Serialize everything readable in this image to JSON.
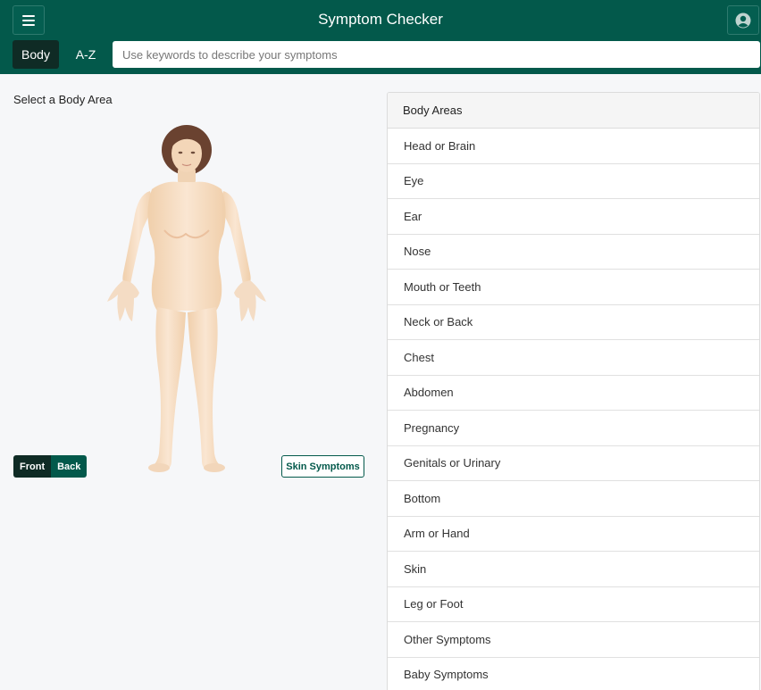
{
  "header": {
    "title": "Symptom Checker",
    "menu_icon": "hamburger-icon",
    "user_icon": "user-account-icon",
    "bg_color": "#03594b"
  },
  "nav": {
    "tabs": [
      {
        "label": "Body",
        "active": true
      },
      {
        "label": "A-Z",
        "active": false
      }
    ],
    "search": {
      "placeholder": "Use keywords to describe your symptoms",
      "value": ""
    }
  },
  "main": {
    "select_label": "Select a Body Area",
    "view_toggle": {
      "front": "Front",
      "back": "Back",
      "selected": "Front"
    },
    "skin_button": "Skin Symptoms"
  },
  "body_areas": {
    "header": "Body Areas",
    "items": [
      "Head or Brain",
      "Eye",
      "Ear",
      "Nose",
      "Mouth or Teeth",
      "Neck or Back",
      "Chest",
      "Abdomen",
      "Pregnancy",
      "Genitals or Urinary",
      "Bottom",
      "Arm or Hand",
      "Skin",
      "Leg or Foot",
      "Other Symptoms",
      "Baby Symptoms"
    ]
  }
}
